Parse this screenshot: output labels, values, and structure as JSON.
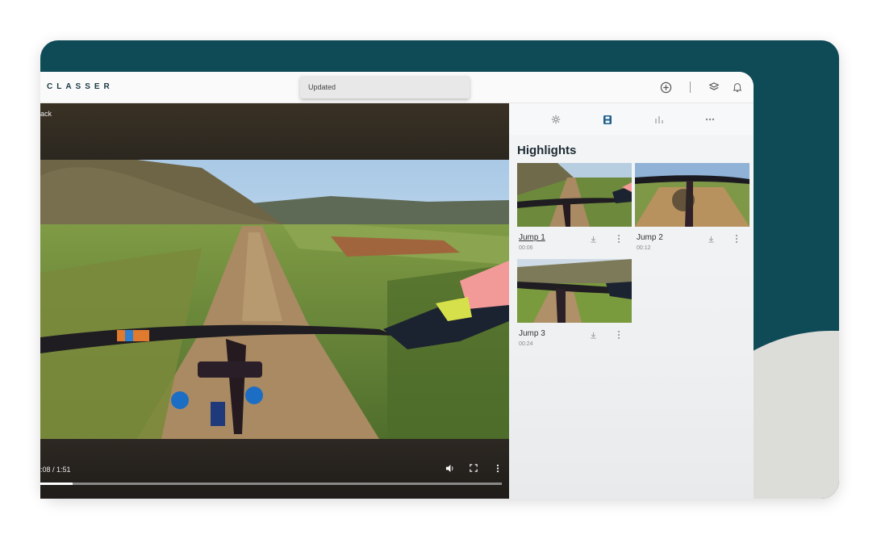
{
  "app": {
    "logo": "CLASSER"
  },
  "toast": {
    "text": "Updated"
  },
  "topbar": {
    "icons": [
      "add-circle-icon",
      "layers-icon",
      "bell-icon"
    ]
  },
  "player": {
    "back_label": "Back",
    "time_display": ":08 / 1:51",
    "progress_fraction": 0.07,
    "controls": [
      "volume-icon",
      "fullscreen-icon",
      "more-vert-icon"
    ]
  },
  "sidebar": {
    "tabs": [
      {
        "icon": "settings-icon",
        "active": false
      },
      {
        "icon": "film-icon",
        "active": true
      },
      {
        "icon": "bar-chart-icon",
        "active": false
      },
      {
        "icon": "more-horiz-icon",
        "active": false
      }
    ],
    "heading": "Highlights",
    "clips": [
      {
        "title": "Jump 1",
        "duration": "00:06"
      },
      {
        "title": "Jump 2",
        "duration": "00:12"
      },
      {
        "title": "Jump 3",
        "duration": "00:24"
      }
    ]
  },
  "colors": {
    "brand_teal": "#0f4a57",
    "active_tab": "#1f5f8b"
  }
}
